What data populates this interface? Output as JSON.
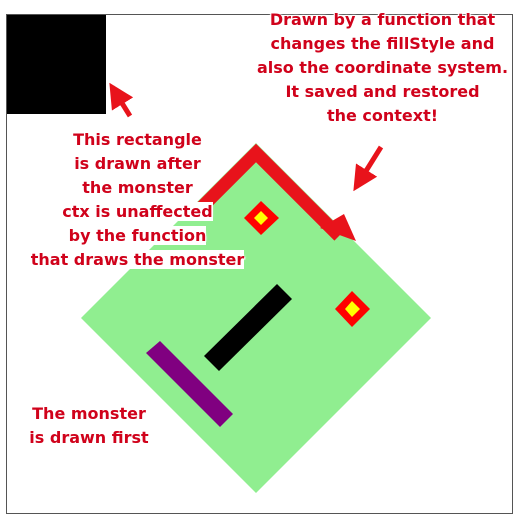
{
  "colors": {
    "annotation": "#d0021b",
    "monster_body": "#90ee90",
    "monster_mouth": "#000000",
    "monster_nose": "#800080",
    "monster_eye_outer": "#ff0000",
    "monster_eye_inner": "#ffff00",
    "rectangle": "#000000",
    "arrow": "#e8131b"
  },
  "annotations": {
    "top_right": [
      "Drawn by a function that",
      "changes the fillStyle and",
      "also the coordinate system.",
      "It saved and restored",
      "the context!"
    ],
    "middle_left": {
      "l1": "This rectangle",
      "l2": "is drawn after",
      "l3": "the monster",
      "l4": "ctx is unaffected",
      "l5a": "by the function",
      "l6a": "that draws the ",
      "l6b": "monster"
    },
    "bottom_left": [
      "The monster",
      "is drawn first"
    ]
  }
}
